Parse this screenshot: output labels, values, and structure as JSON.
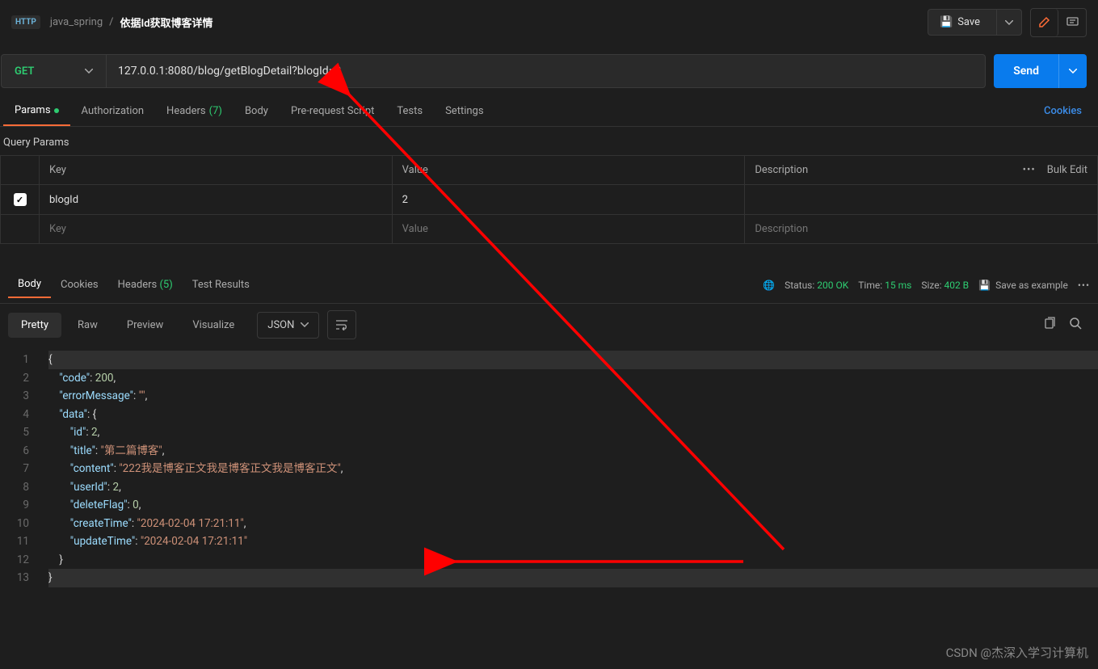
{
  "breadcrumb": {
    "collection": "java_spring",
    "sep": "/",
    "request_name": "依据Id获取博客详情"
  },
  "toolbar": {
    "save_label": "Save"
  },
  "method": "GET",
  "url": "127.0.0.1:8080/blog/getBlogDetail?blogId=2",
  "send_label": "Send",
  "req_tabs": {
    "params": "Params",
    "authorization": "Authorization",
    "headers": "Headers",
    "headers_count": "(7)",
    "body": "Body",
    "prerequest": "Pre-request Script",
    "tests": "Tests",
    "settings": "Settings",
    "cookies_link": "Cookies"
  },
  "query_params_title": "Query Params",
  "params_headers": {
    "key": "Key",
    "value": "Value",
    "description": "Description",
    "bulk": "Bulk Edit"
  },
  "params_rows": [
    {
      "key": "blogId",
      "value": "2",
      "description": ""
    }
  ],
  "params_placeholder": {
    "key": "Key",
    "value": "Value",
    "description": "Description"
  },
  "resp_tabs": {
    "body": "Body",
    "cookies": "Cookies",
    "headers": "Headers",
    "headers_count": "(5)",
    "tests": "Test Results"
  },
  "status": {
    "label": "Status:",
    "value": "200 OK",
    "time_label": "Time:",
    "time_value": "15 ms",
    "size_label": "Size:",
    "size_value": "402 B",
    "save_example": "Save as example"
  },
  "viewer": {
    "pretty": "Pretty",
    "raw": "Raw",
    "preview": "Preview",
    "visualize": "Visualize",
    "format": "JSON"
  },
  "response_body": {
    "code": 200,
    "errorMessage": "",
    "data": {
      "id": 2,
      "title": "第二篇博客",
      "content": "222我是博客正文我是博客正文我是博客正文",
      "userId": 2,
      "deleteFlag": 0,
      "createTime": "2024-02-04 17:21:11",
      "updateTime": "2024-02-04 17:21:11"
    }
  },
  "line_numbers": [
    "1",
    "2",
    "3",
    "4",
    "5",
    "6",
    "7",
    "8",
    "9",
    "10",
    "11",
    "12",
    "13"
  ],
  "watermark": "CSDN @杰深入学习计算机"
}
